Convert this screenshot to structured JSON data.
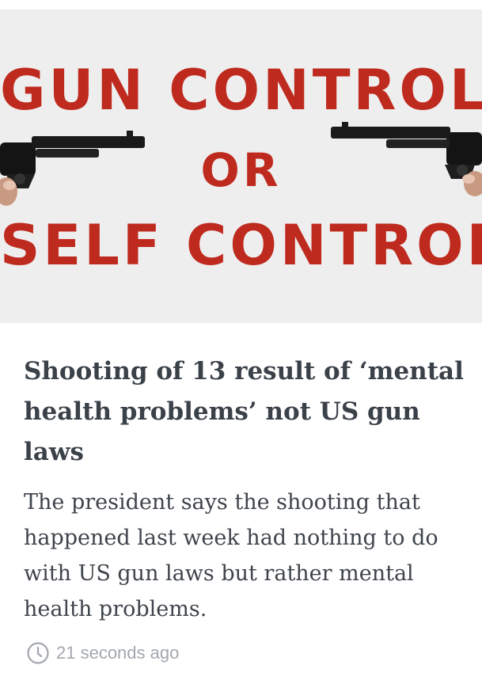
{
  "hero_image": {
    "line1": "GUN CONTROL",
    "line2": "OR",
    "line3": "SELF CONTROL?",
    "icons": [
      "revolver-left-icon",
      "revolver-right-icon"
    ],
    "text_color": "#bf2a1e",
    "background_color": "#eeeeee"
  },
  "article": {
    "headline": "Shooting of 13 result of ‘mental health problems’ not US gun laws",
    "summary": "The president says the shooting that happened last week had nothing to do with US gun laws but rather mental health problems.",
    "timestamp": "21 seconds ago",
    "timestamp_icon": "clock-icon"
  }
}
